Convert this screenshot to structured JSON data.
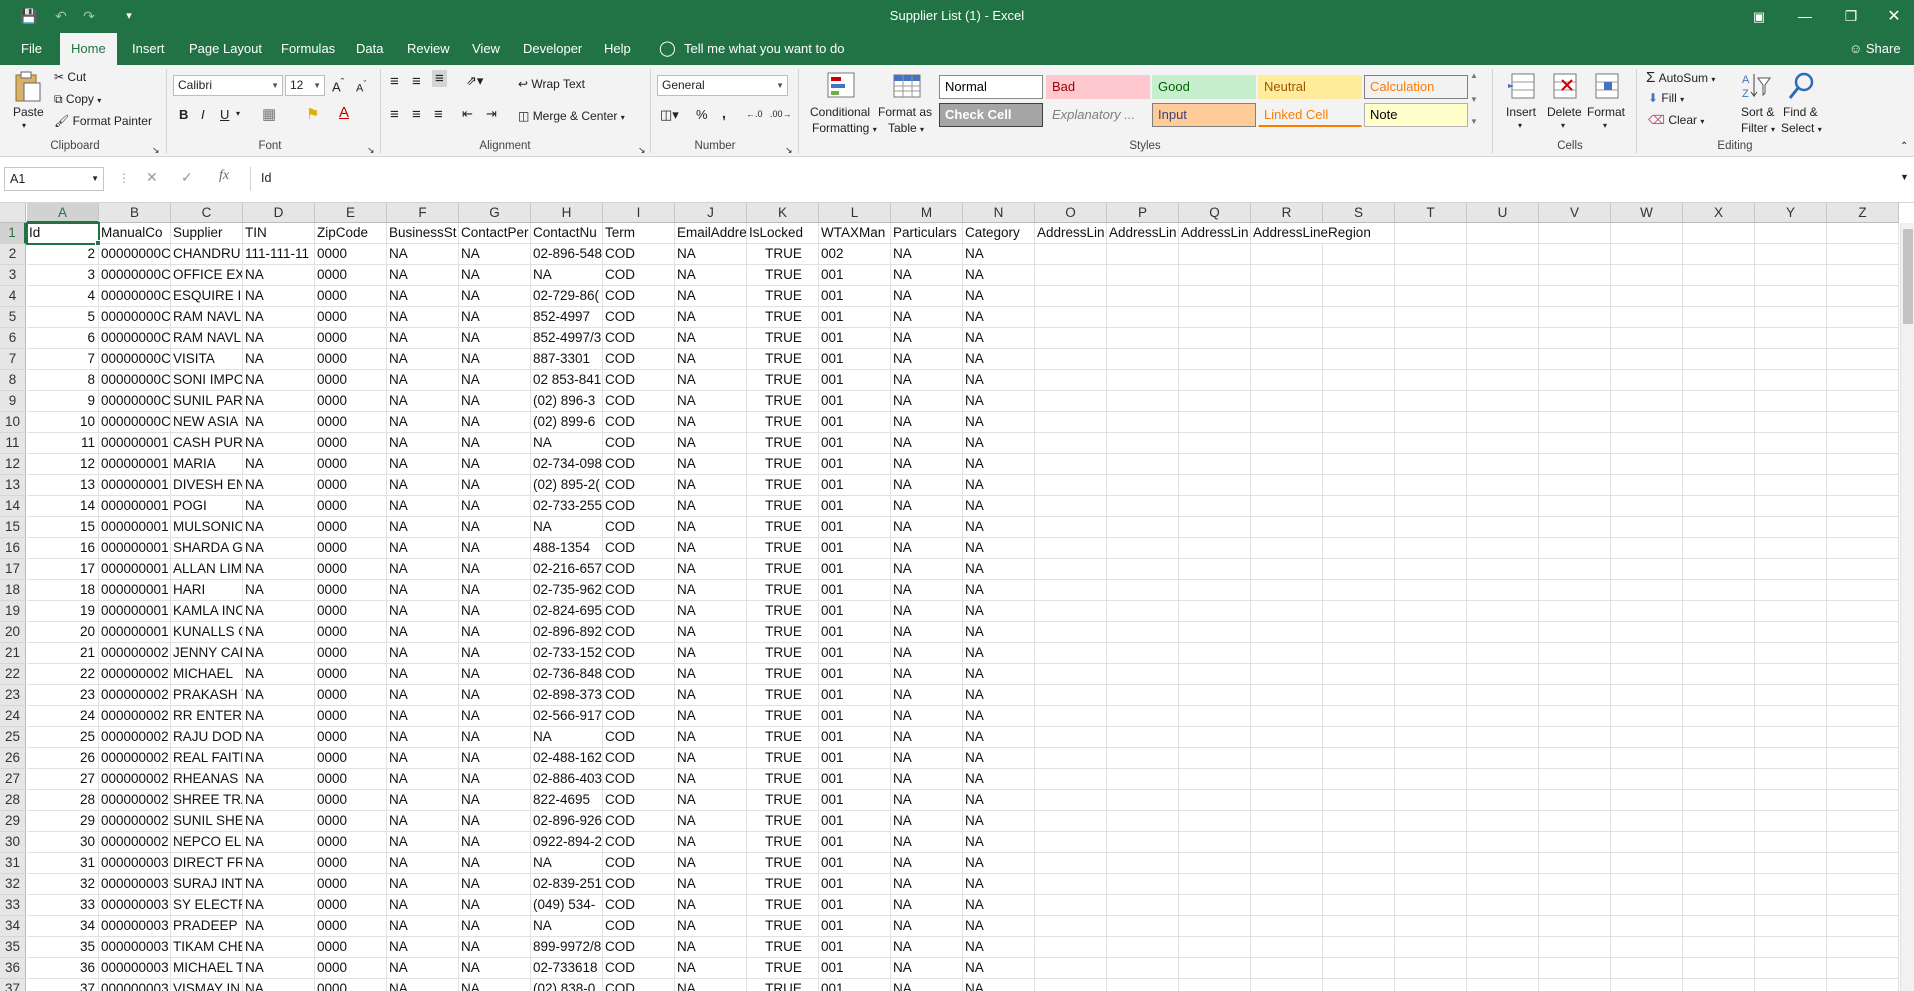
{
  "window": {
    "title": "Supplier List (1)  -  Excel",
    "share": "Share",
    "tell_me": "Tell me what you want to do"
  },
  "tabs": [
    {
      "label": "File"
    },
    {
      "label": "Home"
    },
    {
      "label": "Insert"
    },
    {
      "label": "Page Layout"
    },
    {
      "label": "Formulas"
    },
    {
      "label": "Data"
    },
    {
      "label": "Review"
    },
    {
      "label": "View"
    },
    {
      "label": "Developer"
    },
    {
      "label": "Help"
    }
  ],
  "ribbon": {
    "clipboard": {
      "paste": "Paste",
      "cut": "Cut",
      "copy": "Copy",
      "format_painter": "Format Painter",
      "label": "Clipboard"
    },
    "font": {
      "name": "Calibri",
      "size": "12",
      "label": "Font",
      "bold": "B",
      "italic": "I",
      "underline": "U"
    },
    "alignment": {
      "wrap": "Wrap Text",
      "merge": "Merge & Center",
      "label": "Alignment"
    },
    "number": {
      "format": "General",
      "label": "Number",
      "percent": "%",
      "comma": ","
    },
    "styles": {
      "conditional": "Conditional",
      "conditional2": "Formatting",
      "format_as": "Format as",
      "format_as2": "Table",
      "label": "Styles",
      "cells": [
        {
          "name": "Normal",
          "bg": "#ffffff",
          "fg": "#000000",
          "border": "#8a8a8a"
        },
        {
          "name": "Bad",
          "bg": "#ffc7ce",
          "fg": "#9c0006",
          "border": "#ffc7ce"
        },
        {
          "name": "Good",
          "bg": "#c6efce",
          "fg": "#006100",
          "border": "#c6efce"
        },
        {
          "name": "Neutral",
          "bg": "#ffeb9c",
          "fg": "#9c5700",
          "border": "#ffeb9c"
        },
        {
          "name": "Calculation",
          "bg": "#f2f2f2",
          "fg": "#fa7d00",
          "border": "#7f7f7f"
        },
        {
          "name": "Check Cell",
          "bg": "#a5a5a5",
          "fg": "#ffffff",
          "border": "#3f3f3f"
        },
        {
          "name": "Explanatory ...",
          "bg": "#f3f3f3",
          "fg": "#7f7f7f",
          "border": "#f3f3f3"
        },
        {
          "name": "Input",
          "bg": "#ffcc99",
          "fg": "#3f3f76",
          "border": "#7f7f7f"
        },
        {
          "name": "Linked Cell",
          "bg": "#f3f3f3",
          "fg": "#fa7d00",
          "border": "#f3f3f3"
        },
        {
          "name": "Note",
          "bg": "#ffffcc",
          "fg": "#000000",
          "border": "#b2b2b2"
        }
      ]
    },
    "cells": {
      "insert": "Insert",
      "delete": "Delete",
      "format": "Format",
      "label": "Cells"
    },
    "editing": {
      "autosum": "AutoSum",
      "fill": "Fill",
      "clear": "Clear",
      "sort": "Sort &",
      "sort2": "Filter",
      "find": "Find &",
      "find2": "Select",
      "label": "Editing"
    }
  },
  "formula_bar": {
    "name_box": "A1",
    "value": "Id"
  },
  "columns": [
    "A",
    "B",
    "C",
    "D",
    "E",
    "F",
    "G",
    "H",
    "I",
    "J",
    "K",
    "L",
    "M",
    "N",
    "O",
    "P",
    "Q",
    "R",
    "S",
    "T",
    "U",
    "V",
    "W",
    "X",
    "Y",
    "Z"
  ],
  "header_row": [
    "Id",
    "ManualCo",
    "Supplier",
    "TIN",
    "ZipCode",
    "BusinessSt",
    "ContactPer",
    "ContactNu",
    "Term",
    "EmailAddre",
    "IsLocked",
    "WTAXMan",
    "Particulars",
    "Category",
    "AddressLin",
    "AddressLin",
    "AddressLin",
    "AddressLineRegion"
  ],
  "rows": [
    [
      "2",
      "00000000C",
      "CHANDRU",
      "111-111-11",
      "0000",
      "NA",
      "NA",
      "02-896-548",
      "COD",
      "NA",
      "TRUE",
      "002",
      "NA",
      "NA"
    ],
    [
      "3",
      "00000000C",
      "OFFICE EXI",
      "NA",
      "0000",
      "NA",
      "NA",
      "NA",
      "COD",
      "NA",
      "TRUE",
      "001",
      "NA",
      "NA"
    ],
    [
      "4",
      "00000000C",
      "ESQUIRE IN",
      "NA",
      "0000",
      "NA",
      "NA",
      "02-729-86(",
      "COD",
      "NA",
      "TRUE",
      "001",
      "NA",
      "NA"
    ],
    [
      "5",
      "00000000C",
      "RAM NAVL",
      "NA",
      "0000",
      "NA",
      "NA",
      "852-4997",
      "COD",
      "NA",
      "TRUE",
      "001",
      "NA",
      "NA"
    ],
    [
      "6",
      "00000000C",
      "RAM NAVL",
      "NA",
      "0000",
      "NA",
      "NA",
      "852-4997/3",
      "COD",
      "NA",
      "TRUE",
      "001",
      "NA",
      "NA"
    ],
    [
      "7",
      "00000000C",
      "VISITA",
      "NA",
      "0000",
      "NA",
      "NA",
      "887-3301",
      "COD",
      "NA",
      "TRUE",
      "001",
      "NA",
      "NA"
    ],
    [
      "8",
      "00000000C",
      "SONI IMPC",
      "NA",
      "0000",
      "NA",
      "NA",
      "02 853-841",
      "COD",
      "NA",
      "TRUE",
      "001",
      "NA",
      "NA"
    ],
    [
      "9",
      "00000000C",
      "SUNIL PAR",
      "NA",
      "0000",
      "NA",
      "NA",
      "(02) 896-3",
      "COD",
      "NA",
      "TRUE",
      "001",
      "NA",
      "NA"
    ],
    [
      "10",
      "00000000C",
      "NEW ASIA",
      "NA",
      "0000",
      "NA",
      "NA",
      "(02) 899-6",
      "COD",
      "NA",
      "TRUE",
      "001",
      "NA",
      "NA"
    ],
    [
      "11",
      "000000001",
      "CASH PUR(",
      "NA",
      "0000",
      "NA",
      "NA",
      "NA",
      "COD",
      "NA",
      "TRUE",
      "001",
      "NA",
      "NA"
    ],
    [
      "12",
      "000000001",
      "MARIA",
      "NA",
      "0000",
      "NA",
      "NA",
      "02-734-098",
      "COD",
      "NA",
      "TRUE",
      "001",
      "NA",
      "NA"
    ],
    [
      "13",
      "000000001",
      "DIVESH EN",
      "NA",
      "0000",
      "NA",
      "NA",
      "(02) 895-2(",
      "COD",
      "NA",
      "TRUE",
      "001",
      "NA",
      "NA"
    ],
    [
      "14",
      "000000001",
      "POGI",
      "NA",
      "0000",
      "NA",
      "NA",
      "02-733-255",
      "COD",
      "NA",
      "TRUE",
      "001",
      "NA",
      "NA"
    ],
    [
      "15",
      "000000001",
      "MULSONIC",
      "NA",
      "0000",
      "NA",
      "NA",
      "NA",
      "COD",
      "NA",
      "TRUE",
      "001",
      "NA",
      "NA"
    ],
    [
      "16",
      "000000001",
      "SHARDA G",
      "NA",
      "0000",
      "NA",
      "NA",
      "488-1354",
      "COD",
      "NA",
      "TRUE",
      "001",
      "NA",
      "NA"
    ],
    [
      "17",
      "000000001",
      "ALLAN LIM",
      "NA",
      "0000",
      "NA",
      "NA",
      "02-216-657",
      "COD",
      "NA",
      "TRUE",
      "001",
      "NA",
      "NA"
    ],
    [
      "18",
      "000000001",
      "HARI",
      "NA",
      "0000",
      "NA",
      "NA",
      "02-735-962",
      "COD",
      "NA",
      "TRUE",
      "001",
      "NA",
      "NA"
    ],
    [
      "19",
      "000000001",
      "KAMLA INC",
      "NA",
      "0000",
      "NA",
      "NA",
      "02-824-695",
      "COD",
      "NA",
      "TRUE",
      "001",
      "NA",
      "NA"
    ],
    [
      "20",
      "000000001",
      "KUNALLS G",
      "NA",
      "0000",
      "NA",
      "NA",
      "02-896-892",
      "COD",
      "NA",
      "TRUE",
      "001",
      "NA",
      "NA"
    ],
    [
      "21",
      "000000002",
      "JENNY CAF",
      "NA",
      "0000",
      "NA",
      "NA",
      "02-733-152",
      "COD",
      "NA",
      "TRUE",
      "001",
      "NA",
      "NA"
    ],
    [
      "22",
      "000000002",
      "MICHAEL",
      "NA",
      "0000",
      "NA",
      "NA",
      "02-736-848",
      "COD",
      "NA",
      "TRUE",
      "001",
      "NA",
      "NA"
    ],
    [
      "23",
      "000000002",
      "PRAKASH V",
      "NA",
      "0000",
      "NA",
      "NA",
      "02-898-373",
      "COD",
      "NA",
      "TRUE",
      "001",
      "NA",
      "NA"
    ],
    [
      "24",
      "000000002",
      "RR ENTERF",
      "NA",
      "0000",
      "NA",
      "NA",
      "02-566-917",
      "COD",
      "NA",
      "TRUE",
      "001",
      "NA",
      "NA"
    ],
    [
      "25",
      "000000002",
      "RAJU DOD",
      "NA",
      "0000",
      "NA",
      "NA",
      "NA",
      "COD",
      "NA",
      "TRUE",
      "001",
      "NA",
      "NA"
    ],
    [
      "26",
      "000000002",
      "REAL FAITH",
      "NA",
      "0000",
      "NA",
      "NA",
      "02-488-162",
      "COD",
      "NA",
      "TRUE",
      "001",
      "NA",
      "NA"
    ],
    [
      "27",
      "000000002",
      "RHEANAS I",
      "NA",
      "0000",
      "NA",
      "NA",
      "02-886-403",
      "COD",
      "NA",
      "TRUE",
      "001",
      "NA",
      "NA"
    ],
    [
      "28",
      "000000002",
      "SHREE TRA",
      "NA",
      "0000",
      "NA",
      "NA",
      "822-4695",
      "COD",
      "NA",
      "TRUE",
      "001",
      "NA",
      "NA"
    ],
    [
      "29",
      "000000002",
      "SUNIL SHE",
      "NA",
      "0000",
      "NA",
      "NA",
      "02-896-926",
      "COD",
      "NA",
      "TRUE",
      "001",
      "NA",
      "NA"
    ],
    [
      "30",
      "000000002",
      "NEPCO ELI",
      "NA",
      "0000",
      "NA",
      "NA",
      "0922-894-2",
      "COD",
      "NA",
      "TRUE",
      "001",
      "NA",
      "NA"
    ],
    [
      "31",
      "000000003",
      "DIRECT FR",
      "NA",
      "0000",
      "NA",
      "NA",
      "NA",
      "COD",
      "NA",
      "TRUE",
      "001",
      "NA",
      "NA"
    ],
    [
      "32",
      "000000003",
      "SURAJ INT",
      "NA",
      "0000",
      "NA",
      "NA",
      "02-839-251",
      "COD",
      "NA",
      "TRUE",
      "001",
      "NA",
      "NA"
    ],
    [
      "33",
      "000000003",
      "SY ELECTR",
      "NA",
      "0000",
      "NA",
      "NA",
      "(049) 534-",
      "COD",
      "NA",
      "TRUE",
      "001",
      "NA",
      "NA"
    ],
    [
      "34",
      "000000003",
      "PRADEEP N",
      "NA",
      "0000",
      "NA",
      "NA",
      "NA",
      "COD",
      "NA",
      "TRUE",
      "001",
      "NA",
      "NA"
    ],
    [
      "35",
      "000000003",
      "TIKAM CHE",
      "NA",
      "0000",
      "NA",
      "NA",
      "899-9972/8",
      "COD",
      "NA",
      "TRUE",
      "001",
      "NA",
      "NA"
    ],
    [
      "36",
      "000000003",
      "MICHAEL T",
      "NA",
      "0000",
      "NA",
      "NA",
      "02-733618",
      "COD",
      "NA",
      "TRUE",
      "001",
      "NA",
      "NA"
    ],
    [
      "37",
      "000000003",
      "VISMAY IN",
      "NA",
      "0000",
      "NA",
      "NA",
      "(02) 838-0",
      "COD",
      "NA",
      "TRUE",
      "001",
      "NA",
      "NA"
    ]
  ],
  "accent": "#217346"
}
